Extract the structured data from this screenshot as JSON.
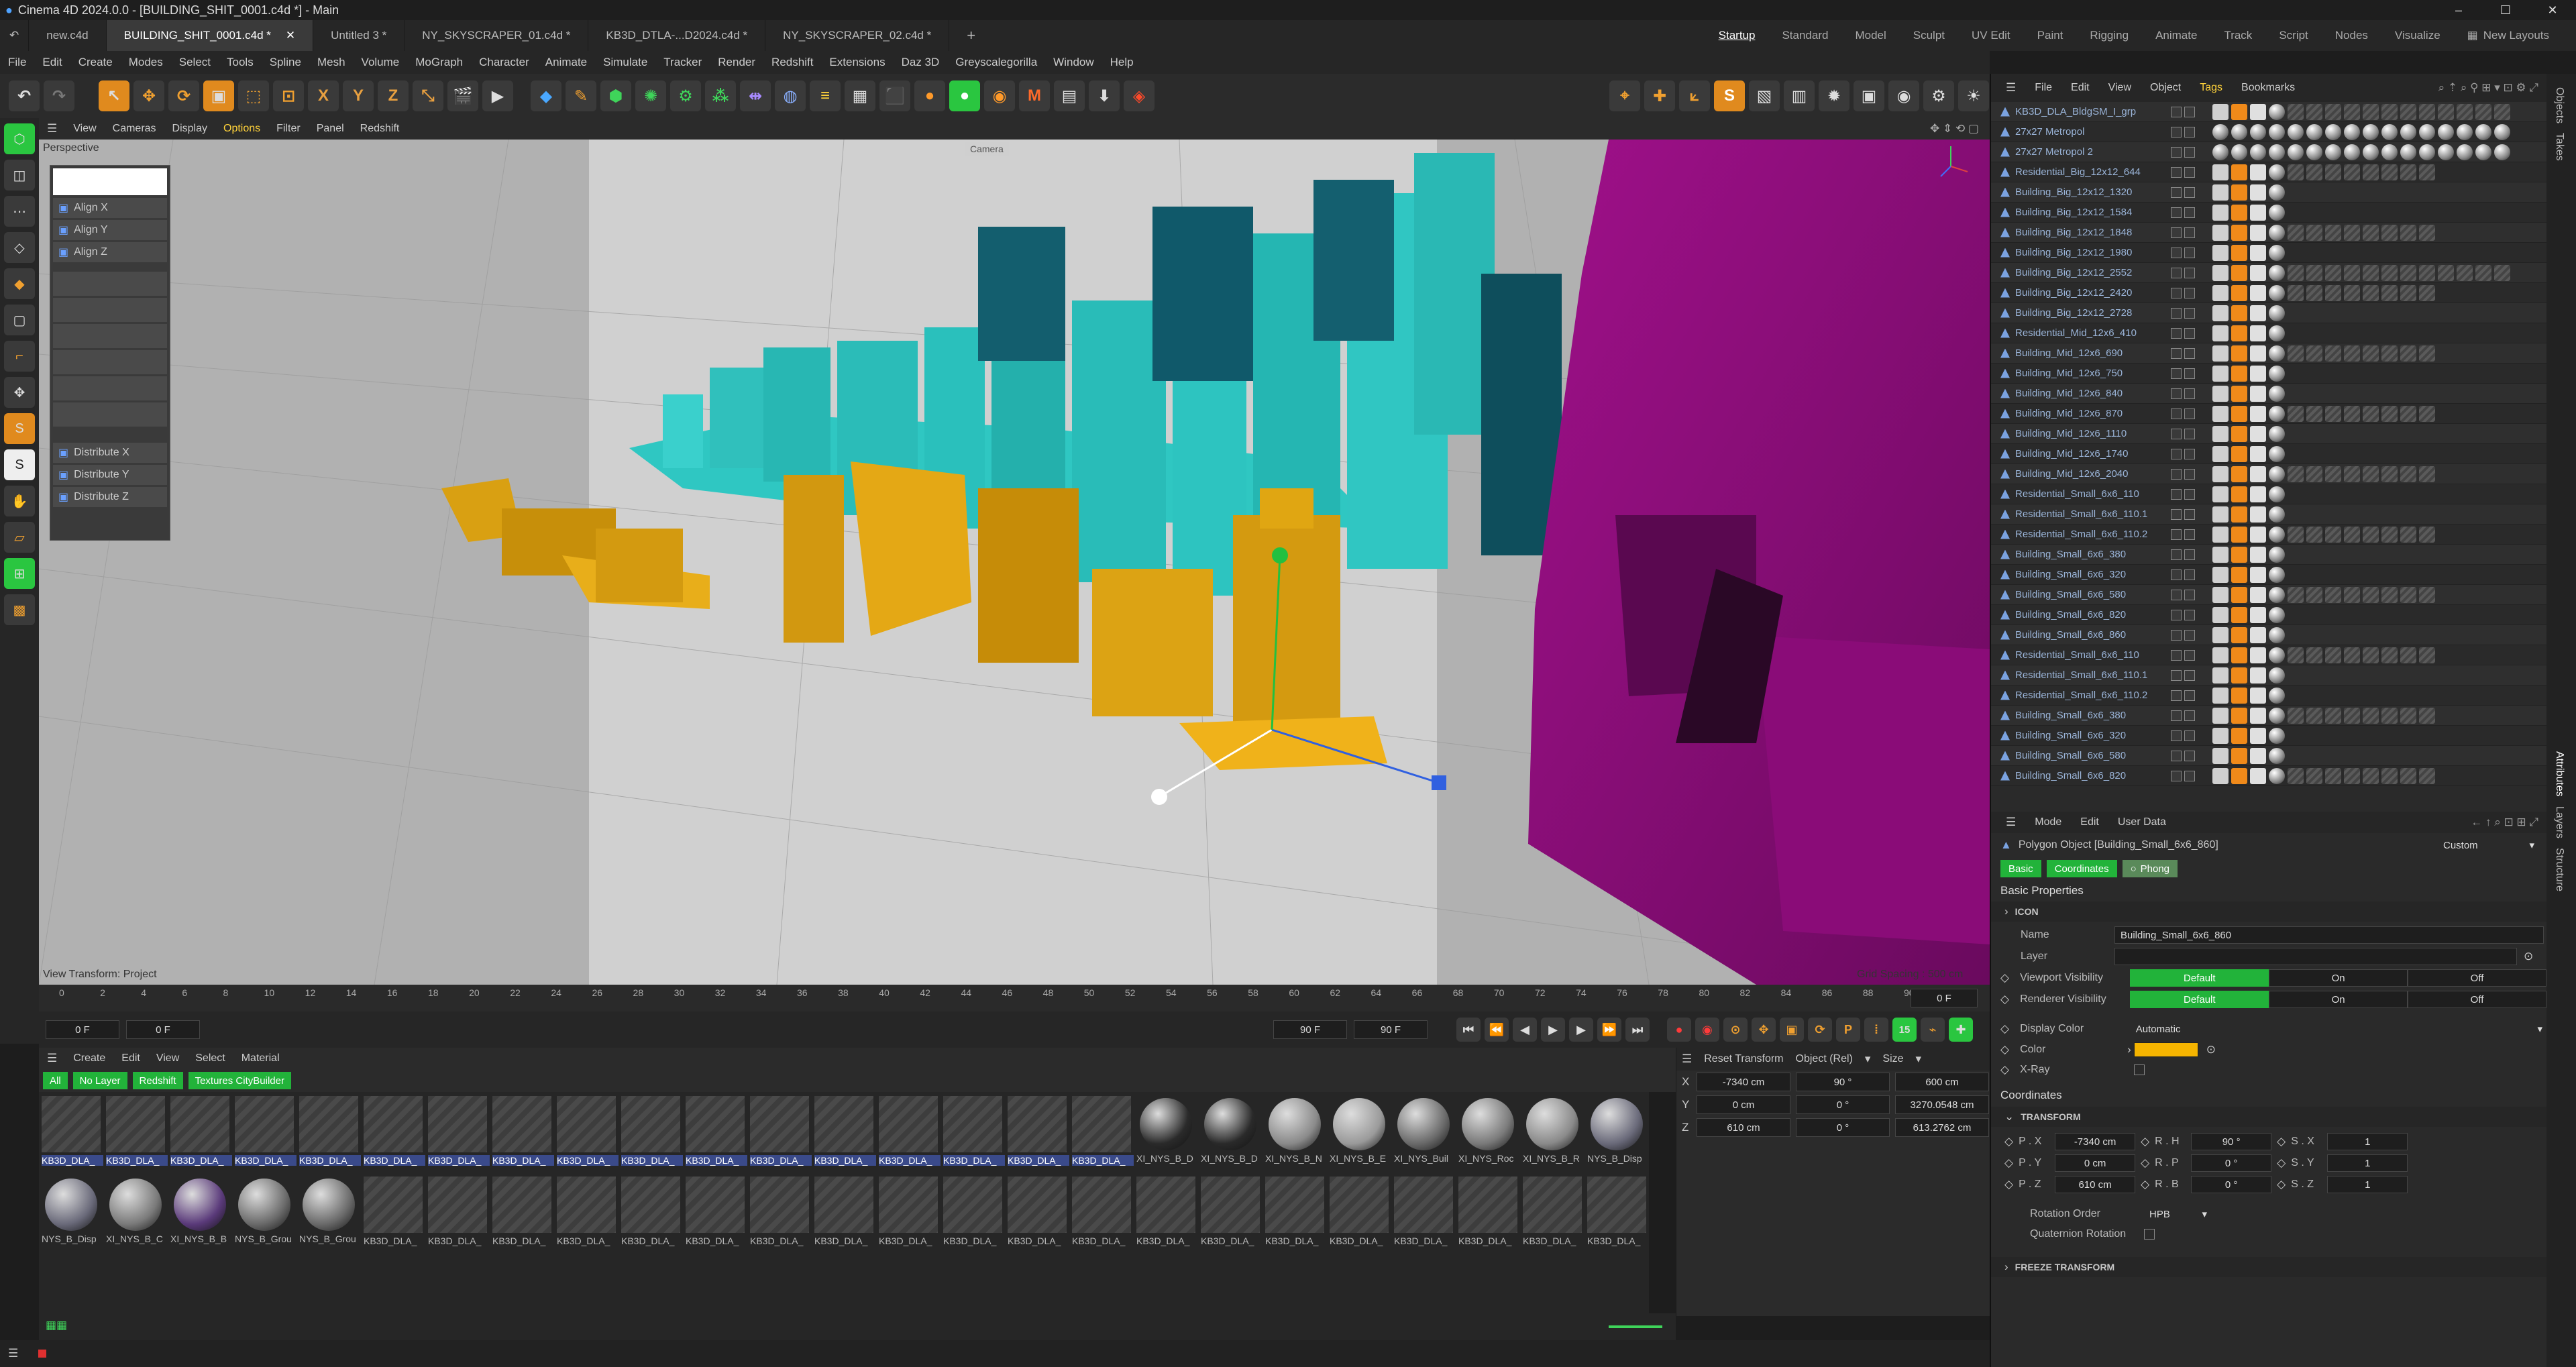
{
  "window": {
    "title": "Cinema 4D 2024.0.0 - [BUILDING_SHIT_0001.c4d *] - Main"
  },
  "doc_tabs": [
    {
      "label": "new.c4d"
    },
    {
      "label": "BUILDING_SHIT_0001.c4d *",
      "active": true
    },
    {
      "label": "Untitled 3 *"
    },
    {
      "label": "NY_SKYSCRAPER_01.c4d *"
    },
    {
      "label": "KB3D_DTLA-...D2024.c4d *"
    },
    {
      "label": "NY_SKYSCRAPER_02.c4d *"
    }
  ],
  "layouts": [
    {
      "label": "Startup",
      "active": true
    },
    {
      "label": "Standard"
    },
    {
      "label": "Model"
    },
    {
      "label": "Sculpt"
    },
    {
      "label": "UV Edit"
    },
    {
      "label": "Paint"
    },
    {
      "label": "Rigging"
    },
    {
      "label": "Animate"
    },
    {
      "label": "Track"
    },
    {
      "label": "Script"
    },
    {
      "label": "Nodes"
    },
    {
      "label": "Visualize"
    }
  ],
  "new_layouts": "New Layouts",
  "menu": [
    "File",
    "Edit",
    "Create",
    "Modes",
    "Select",
    "Tools",
    "Spline",
    "Mesh",
    "Volume",
    "MoGraph",
    "Character",
    "Animate",
    "Simulate",
    "Tracker",
    "Render",
    "Redshift",
    "Extensions",
    "Daz 3D",
    "Greyscalegorilla",
    "Window",
    "Help"
  ],
  "viewport": {
    "menu": [
      "View",
      "Cameras",
      "Display",
      "Options",
      "Filter",
      "Panel",
      "Redshift"
    ],
    "name": "Perspective",
    "camera": "Camera",
    "view_transform": "View Transform: Project",
    "grid_spacing": "Grid Spacing : 500 cm"
  },
  "align_panel": {
    "items": [
      "Align X",
      "Align Y",
      "Align Z",
      "Distribute X",
      "Distribute Y",
      "Distribute Z"
    ]
  },
  "timeline": {
    "ticks": [
      "0",
      "2",
      "4",
      "6",
      "8",
      "10",
      "12",
      "14",
      "16",
      "18",
      "20",
      "22",
      "24",
      "26",
      "28",
      "30",
      "32",
      "34",
      "36",
      "38",
      "40",
      "42",
      "44",
      "46",
      "48",
      "50",
      "52",
      "54",
      "56",
      "58",
      "60",
      "62",
      "64",
      "66",
      "68",
      "70",
      "72",
      "74",
      "76",
      "78",
      "80",
      "82",
      "84",
      "86",
      "88",
      "90"
    ],
    "current": "0 F",
    "start": "0 F",
    "start2": "0 F",
    "end": "90 F",
    "end2": "90 F",
    "fps": "15"
  },
  "materials": {
    "menu": [
      "Create",
      "Edit",
      "View",
      "Select",
      "Material"
    ],
    "filters": [
      "All",
      "No Layer",
      "Redshift",
      "Textures CityBuilder"
    ],
    "row1": [
      "KB3D_DLA_",
      "KB3D_DLA_",
      "KB3D_DLA_",
      "KB3D_DLA_",
      "KB3D_DLA_",
      "KB3D_DLA_",
      "KB3D_DLA_",
      "KB3D_DLA_",
      "KB3D_DLA_",
      "KB3D_DLA_",
      "KB3D_DLA_",
      "KB3D_DLA_",
      "KB3D_DLA_",
      "KB3D_DLA_",
      "KB3D_DLA_",
      "KB3D_DLA_",
      "KB3D_DLA_",
      "XI_NYS_B_D",
      "XI_NYS_B_D",
      "XI_NYS_B_N",
      "XI_NYS_B_E",
      "XI_NYS_Buil",
      "XI_NYS_Roc",
      "XI_NYS_B_R",
      "NYS_B_Disp"
    ],
    "row2": [
      "NYS_B_Disp",
      "XI_NYS_B_C",
      "XI_NYS_B_B",
      "NYS_B_Grou",
      "NYS_B_Grou",
      "KB3D_DLA_",
      "KB3D_DLA_",
      "KB3D_DLA_",
      "KB3D_DLA_",
      "KB3D_DLA_",
      "KB3D_DLA_",
      "KB3D_DLA_",
      "KB3D_DLA_",
      "KB3D_DLA_",
      "KB3D_DLA_",
      "KB3D_DLA_",
      "KB3D_DLA_",
      "KB3D_DLA_",
      "KB3D_DLA_",
      "KB3D_DLA_",
      "KB3D_DLA_",
      "KB3D_DLA_",
      "KB3D_DLA_",
      "KB3D_DLA_",
      "KB3D_DLA_"
    ]
  },
  "coords": {
    "reset": "Reset Transform",
    "mode": "Object (Rel)",
    "size": "Size",
    "rows": [
      {
        "axis": "X",
        "pos": "-7340 cm",
        "rot": "90 °",
        "size": "600 cm"
      },
      {
        "axis": "Y",
        "pos": "0 cm",
        "rot": "0 °",
        "size": "3270.0548 cm"
      },
      {
        "axis": "Z",
        "pos": "610 cm",
        "rot": "0 °",
        "size": "613.2762 cm"
      }
    ]
  },
  "objects": {
    "menu": [
      "File",
      "Edit",
      "View",
      "Object",
      "Tags",
      "Bookmarks"
    ],
    "items": [
      "KB3D_DLA_BldgSM_I_grp",
      "27x27 Metropol",
      "27x27 Metropol 2",
      "Residential_Big_12x12_644",
      "Building_Big_12x12_1320",
      "Building_Big_12x12_1584",
      "Building_Big_12x12_1848",
      "Building_Big_12x12_1980",
      "Building_Big_12x12_2552",
      "Building_Big_12x12_2420",
      "Building_Big_12x12_2728",
      "Residential_Mid_12x6_410",
      "Building_Mid_12x6_690",
      "Building_Mid_12x6_750",
      "Building_Mid_12x6_840",
      "Building_Mid_12x6_870",
      "Building_Mid_12x6_1110",
      "Building_Mid_12x6_1740",
      "Building_Mid_12x6_2040",
      "Residential_Small_6x6_110",
      "Residential_Small_6x6_110.1",
      "Residential_Small_6x6_110.2",
      "Building_Small_6x6_380",
      "Building_Small_6x6_320",
      "Building_Small_6x6_580",
      "Building_Small_6x6_820",
      "Building_Small_6x6_860",
      "Residential_Small_6x6_110",
      "Residential_Small_6x6_110.1",
      "Residential_Small_6x6_110.2",
      "Building_Small_6x6_380",
      "Building_Small_6x6_320",
      "Building_Small_6x6_580",
      "Building_Small_6x6_820"
    ]
  },
  "attributes": {
    "menu": [
      "Mode",
      "Edit",
      "User Data"
    ],
    "object": "Polygon Object [Building_Small_6x6_860]",
    "preset": "Custom",
    "tabs": [
      "Basic",
      "Coordinates",
      "Phong"
    ],
    "section": "Basic Properties",
    "icon_group": "ICON",
    "name_label": "Name",
    "name": "Building_Small_6x6_860",
    "layer_label": "Layer",
    "viewport_visibility": "Viewport Visibility",
    "renderer_visibility": "Renderer Visibility",
    "vis_options": [
      "Default",
      "On",
      "Off"
    ],
    "display_color": "Display Color",
    "display_color_value": "Automatic",
    "color_label": "Color",
    "xray": "X-Ray",
    "color_hex": "#f5b400",
    "coordinates": "Coordinates",
    "transform": "TRANSFORM",
    "px": "-7340 cm",
    "py": "0 cm",
    "pz": "610 cm",
    "rh": "90 °",
    "rp": "0 °",
    "rb": "0 °",
    "sx": "1",
    "sy": "1",
    "sz": "1",
    "labels": {
      "px": "P . X",
      "py": "P . Y",
      "pz": "P . Z",
      "rh": "R . H",
      "rp": "R . P",
      "rb": "R . B",
      "sx": "S . X",
      "sy": "S . Y",
      "sz": "S . Z"
    },
    "rotation_order": "Rotation Order",
    "rotation_order_value": "HPB",
    "quaternion": "Quaternion Rotation",
    "freeze": "FREEZE TRANSFORM"
  },
  "right_tabs": [
    "Objects",
    "Takes",
    "Attributes",
    "Layers",
    "Structure"
  ]
}
